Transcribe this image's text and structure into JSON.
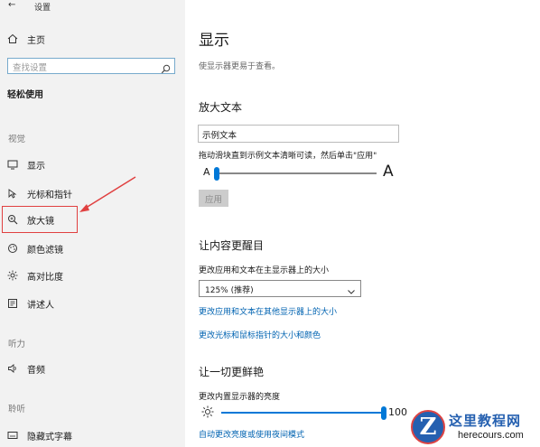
{
  "window": {
    "title": "设置"
  },
  "sidebar": {
    "home": "主页",
    "search_placeholder": "查找设置",
    "section_title": "轻松使用",
    "group_vision": "视觉",
    "items": [
      {
        "label": "显示",
        "icon": "monitor-icon"
      },
      {
        "label": "光标和指针",
        "icon": "cursor-icon"
      },
      {
        "label": "放大镜",
        "icon": "magnifier-icon"
      },
      {
        "label": "颜色滤镜",
        "icon": "palette-icon"
      },
      {
        "label": "高对比度",
        "icon": "contrast-icon"
      },
      {
        "label": "讲述人",
        "icon": "narrator-icon"
      }
    ],
    "group_hearing": "听力",
    "audio": "音频",
    "group_interaction": "聆听",
    "captions": "隐藏式字幕",
    "highlight_color": "#e04040"
  },
  "main": {
    "title": "显示",
    "subtitle": "使显示器更易于查看。",
    "bigger_text": {
      "heading": "放大文本",
      "sample": "示例文本",
      "instruction": "拖动滑块直到示例文本清晰可读，然后单击\"应用\"",
      "min_label": "A",
      "max_label": "A",
      "slider_value": 0.0,
      "apply": "应用"
    },
    "make_bigger": {
      "heading": "让内容更醒目",
      "label": "更改应用和文本在主显示器上的大小",
      "scale_value": "125% (推荐)",
      "link1": "更改应用和文本在其他显示器上的大小",
      "link2": "更改光标和鼠标指针的大小和颜色"
    },
    "brightness": {
      "heading": "让一切更鲜艳",
      "label": "更改内置显示器的亮度",
      "value": "100",
      "slider_value": 1.0,
      "link": "自动更改亮度或使用夜间模式"
    },
    "accent_color": "#0078d7",
    "link_color": "#0063b1"
  },
  "watermark": {
    "name": "这里教程网",
    "url": "herecours.com",
    "badge": "Z"
  }
}
